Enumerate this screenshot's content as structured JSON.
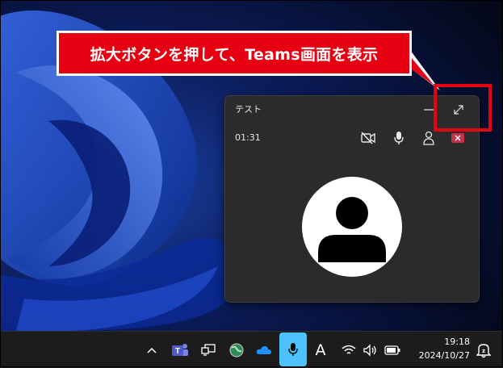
{
  "callout": {
    "text": "拡大ボタンを押して、Teams画面を表示"
  },
  "mini_window": {
    "title": "テスト",
    "timer": "01:31",
    "controls": [
      "camera-off-icon",
      "microphone-icon",
      "share-icon",
      "leave-icon"
    ]
  },
  "taskbar": {
    "ime_label": "A",
    "time": "19:18",
    "date": "2024/10/27",
    "tray_icons": [
      "chevron-up-icon",
      "teams-icon",
      "display-icon",
      "globe-icon",
      "onedrive-icon",
      "microphone-icon",
      "wifi-icon",
      "speaker-icon",
      "battery-icon",
      "notification-bell-icon"
    ]
  },
  "colors": {
    "callout_red": "#e60012",
    "mic_active": "#4cc2ff",
    "leave_red": "#c4314b",
    "taskbar_bg": "#1c1c1c",
    "window_bg": "#2b2b2b"
  }
}
